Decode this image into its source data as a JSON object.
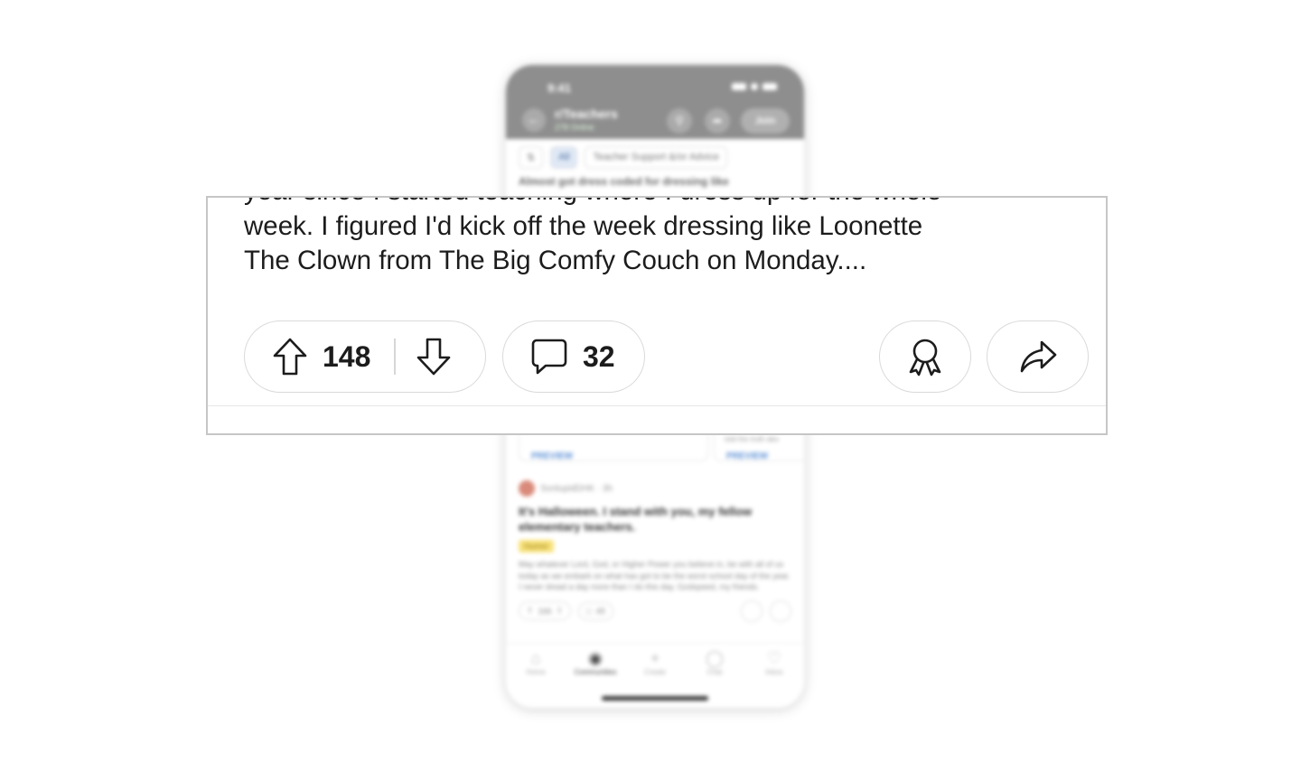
{
  "background_app": {
    "status_time": "9:41",
    "subreddit": "r/Teachers",
    "online": "278 Online",
    "join_label": "Join",
    "filters": [
      "All",
      "Teacher Support &/or Advice"
    ],
    "post_snippet": "Almost got dress coded for dressing like",
    "preview_label": "PREVIEW",
    "card_snippet": "told the truth abo",
    "next_post": {
      "author": "SonlupidDHK · 3h",
      "title": "It's Halloween. I stand with you, my fellow elementary teachers.",
      "flair": "Humor",
      "body": "May whatever Lord, God, or Higher Power you believe in, be with all of us today as we embark on what has got to be the worst school day of the year. I never dread a day more than I do this day. Godspeed, my friends.",
      "upvotes": "166",
      "comments": "49"
    },
    "tabs": [
      "Home",
      "Communities",
      "Create",
      "Chat",
      "Inbox"
    ],
    "accent_color": "#8e8e8e",
    "flair_color": "#f8e27a"
  },
  "zoom": {
    "post_text": "year since I started teaching where I dress up for the whole\nweek. I figured I'd kick off the week dressing like Loonette\nThe Clown from The Big Comfy Couch on Monday....",
    "upvote_count": "148",
    "comment_count": "32",
    "icons": {
      "upvote": "arrow-up-icon",
      "downvote": "arrow-down-icon",
      "comment": "speech-bubble-icon",
      "award": "award-ribbon-icon",
      "share": "share-arrow-icon"
    }
  }
}
